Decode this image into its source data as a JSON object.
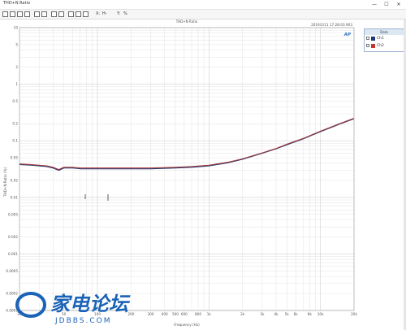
{
  "window": {
    "title": "THD+N Ratio",
    "minimize": "—",
    "maximize": "☐",
    "close": "✕"
  },
  "toolbar": {
    "x_label": "X:",
    "x_value": "H-",
    "y_label": "Y:",
    "y_value": "%"
  },
  "plot": {
    "title": "THD+N Ratio",
    "timestamp": "2019/2/11 17:28:03.903",
    "badge": "AP",
    "ylabel": "THD+N Ratio (%)",
    "xlabel": "Frequency (Hz)"
  },
  "legend": {
    "header": "Data",
    "items": [
      {
        "label": "Ch1",
        "color": "#1f3a7a"
      },
      {
        "label": "Ch2",
        "color": "#c0392b"
      }
    ]
  },
  "watermark": {
    "text": "家电论坛",
    "url": "JDBBS.COM"
  },
  "colors": {
    "ch1": "#1f3a7a",
    "ch2": "#a23838",
    "grid": "#d0d0d0"
  },
  "chart_data": {
    "type": "line",
    "title": "THD+N Ratio",
    "xlabel": "Frequency (Hz)",
    "ylabel": "THD+N Ratio (%)",
    "xscale": "log",
    "yscale": "log",
    "xlim": [
      20,
      20000
    ],
    "ylim": [
      0.0001,
      10
    ],
    "grid": true,
    "legend": "top-right outside",
    "x_ticks": [
      "20",
      "50",
      "100",
      "200",
      "300",
      "400",
      "500",
      "600",
      "800",
      "1k",
      "2k",
      "3k",
      "4k",
      "5k",
      "6k",
      "8k",
      "10k",
      "20k"
    ],
    "x_tick_values": [
      20,
      50,
      100,
      200,
      300,
      400,
      500,
      600,
      800,
      1000,
      2000,
      3000,
      4000,
      5000,
      6000,
      8000,
      10000,
      20000
    ],
    "y_ticks": [
      "10",
      "5",
      "2",
      "1",
      "0.5",
      "0.2",
      "0.1",
      "0.05",
      "0.02",
      "0.01",
      "0.005",
      "0.002",
      "0.001",
      "0.0005",
      "0.0002",
      "0.0001"
    ],
    "y_tick_values": [
      10,
      5,
      2,
      1,
      0.5,
      0.2,
      0.1,
      0.05,
      0.02,
      0.01,
      0.005,
      0.002,
      0.001,
      0.0005,
      0.0002,
      0.0001
    ],
    "x": [
      20,
      25,
      30,
      35,
      40,
      45,
      50,
      60,
      70,
      80,
      100,
      120,
      150,
      200,
      300,
      500,
      700,
      1000,
      1500,
      2000,
      3000,
      4000,
      5000,
      7000,
      10000,
      15000,
      20000
    ],
    "series": [
      {
        "name": "Ch1",
        "values": [
          0.038,
          0.037,
          0.036,
          0.035,
          0.033,
          0.03,
          0.033,
          0.033,
          0.032,
          0.032,
          0.032,
          0.032,
          0.032,
          0.032,
          0.032,
          0.033,
          0.034,
          0.036,
          0.041,
          0.047,
          0.06,
          0.072,
          0.085,
          0.108,
          0.145,
          0.198,
          0.245
        ]
      },
      {
        "name": "Ch2",
        "values": [
          0.039,
          0.038,
          0.037,
          0.036,
          0.034,
          0.031,
          0.034,
          0.034,
          0.033,
          0.033,
          0.033,
          0.033,
          0.033,
          0.033,
          0.033,
          0.034,
          0.035,
          0.037,
          0.042,
          0.048,
          0.061,
          0.073,
          0.087,
          0.11,
          0.148,
          0.202,
          0.25
        ]
      }
    ]
  }
}
